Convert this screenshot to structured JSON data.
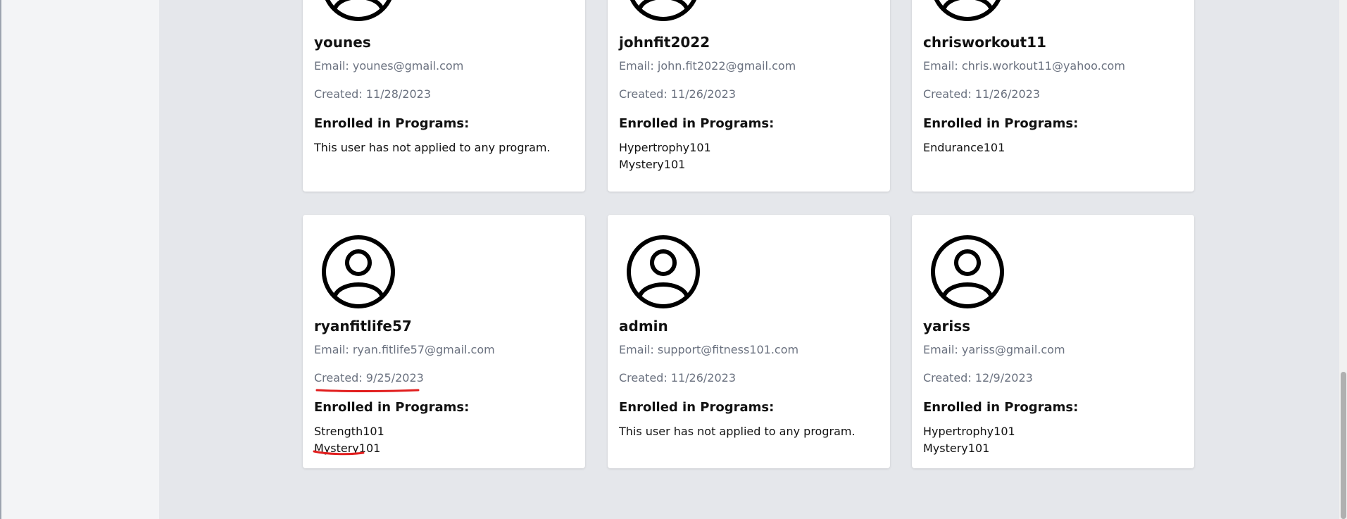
{
  "users": [
    {
      "username": "younes",
      "email": "Email: younes@gmail.com",
      "created": "Created: 11/28/2023",
      "programs_heading": "Enrolled in Programs:",
      "programs": [],
      "empty_message": "This user has not applied to any program."
    },
    {
      "username": "johnfit2022",
      "email": "Email: john.fit2022@gmail.com",
      "created": "Created: 11/26/2023",
      "programs_heading": "Enrolled in Programs:",
      "programs": [
        "Hypertrophy101",
        "Mystery101"
      ],
      "empty_message": ""
    },
    {
      "username": "chrisworkout11",
      "email": "Email: chris.workout11@yahoo.com",
      "created": "Created: 11/26/2023",
      "programs_heading": "Enrolled in Programs:",
      "programs": [
        "Endurance101"
      ],
      "empty_message": ""
    },
    {
      "username": "ryanfitlife57",
      "email": "Email: ryan.fitlife57@gmail.com",
      "created": "Created: 9/25/2023",
      "programs_heading": "Enrolled in Programs:",
      "programs": [
        "Strength101",
        "Mystery101"
      ],
      "empty_message": ""
    },
    {
      "username": "admin",
      "email": "Email: support@fitness101.com",
      "created": "Created: 11/26/2023",
      "programs_heading": "Enrolled in Programs:",
      "programs": [],
      "empty_message": "This user has not applied to any program."
    },
    {
      "username": "yariss",
      "email": "Email: yariss@gmail.com",
      "created": "Created: 12/9/2023",
      "programs_heading": "Enrolled in Programs:",
      "programs": [
        "Hypertrophy101",
        "Mystery101"
      ],
      "empty_message": ""
    }
  ],
  "colors": {
    "page_bg": "#e5e7eb",
    "card_bg": "#ffffff",
    "muted_text": "#6b7280",
    "annotation": "#e11d1d"
  }
}
